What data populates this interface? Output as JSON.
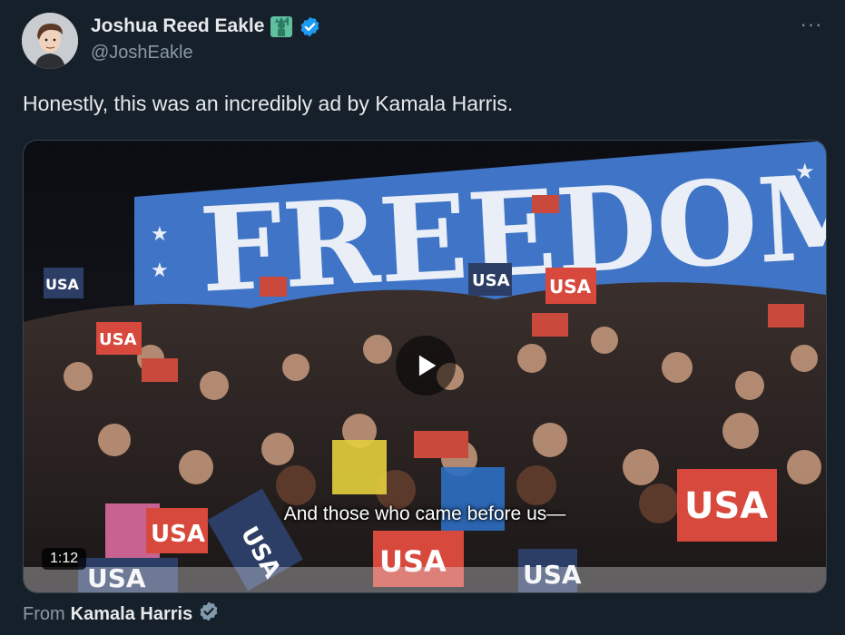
{
  "author": {
    "display_name": "Joshua Reed Eakle",
    "handle": "@JoshEakle",
    "emoji_icon": "statue-of-liberty-icon",
    "verified_icon": "verified-badge-icon"
  },
  "more_icon": "more-options-icon",
  "more_label": "···",
  "tweet": {
    "text": "Honestly, this was an incredibly ad by Kamala Harris."
  },
  "media": {
    "banner_text": "FREEDOM",
    "sign_text": "USA",
    "caption": "And those who came before us—",
    "duration": "1:12",
    "play_icon": "play-icon"
  },
  "source": {
    "from_label": "From",
    "name": "Kamala Harris",
    "badge_icon": "government-verified-icon"
  },
  "colors": {
    "background": "#15202b",
    "text_primary": "#e7e9ea",
    "text_secondary": "#8b98a5",
    "verified_blue": "#1d9bf0",
    "banner_blue": "#3f74c6",
    "sign_red": "#d8493d"
  }
}
